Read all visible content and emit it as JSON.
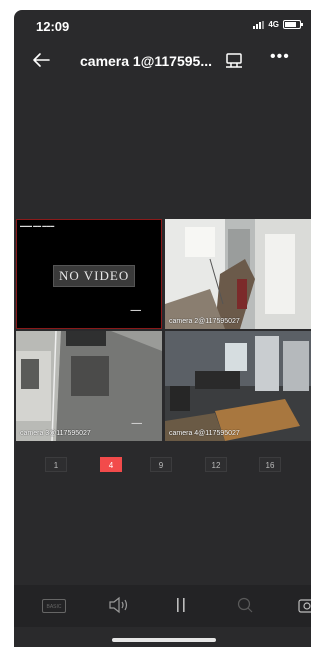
{
  "status": {
    "time": "12:09",
    "network": "4G"
  },
  "header": {
    "title": "camera 1@117595..."
  },
  "cameras": [
    {
      "label": "",
      "message": "NO VIDEO"
    },
    {
      "label": "camera 2@117595027"
    },
    {
      "label": "camera 3@117595027"
    },
    {
      "label": "camera 4@117595027"
    }
  ],
  "split_options": [
    "1",
    "4",
    "9",
    "12",
    "16"
  ],
  "split_selected": "4",
  "toolbar": {
    "basic_label": "BASIC"
  },
  "colors": {
    "accent": "#f24b4b",
    "background": "#2a2a2c"
  }
}
